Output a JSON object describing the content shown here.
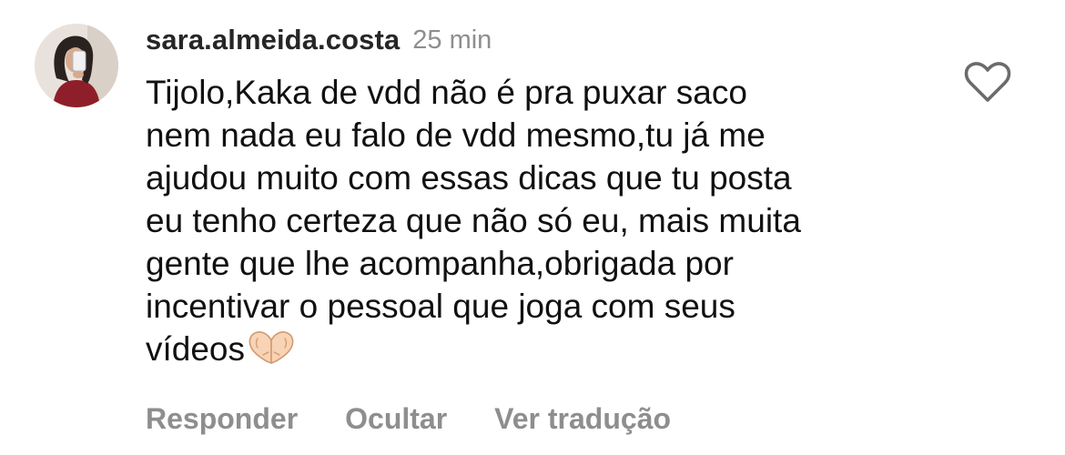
{
  "comment": {
    "username": "sara.almeida.costa",
    "time": "25 min",
    "lines": [
      "Tijolo,Kaka de vdd não é pra puxar saco",
      "nem nada eu falo de vdd mesmo,tu já me",
      "ajudou muito com essas dicas que tu posta",
      "eu tenho certeza que não só eu, mais muita",
      "gente que lhe acompanha,obrigada por",
      "incentivar o pessoal que joga com seus",
      "vídeos"
    ],
    "emoji": "heart-hands-icon"
  },
  "actions": {
    "reply": "Responder",
    "hide": "Ocultar",
    "translate": "Ver tradução"
  },
  "icons": {
    "like": "heart-outline-icon"
  },
  "colors": {
    "text": "#111111",
    "username": "#262626",
    "muted": "#8e8e8e",
    "background": "#ffffff"
  }
}
